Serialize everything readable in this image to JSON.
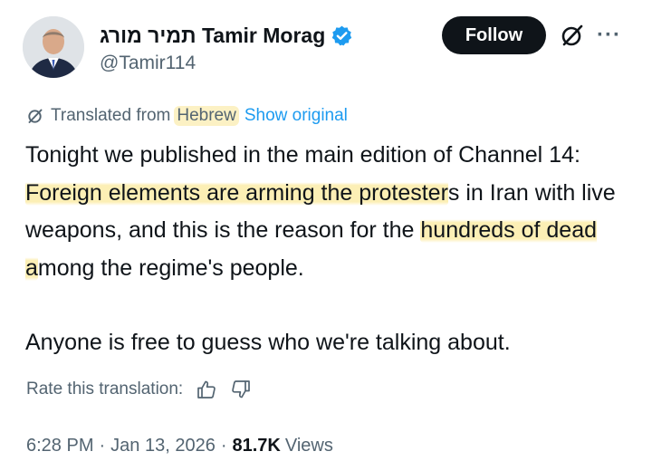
{
  "author": {
    "display_name": "תמיר מורג Tamir Morag",
    "handle": "@Tamir114",
    "avatar_icon": "avatar-portrait",
    "verified_icon": "verified-badge-icon"
  },
  "actions": {
    "follow_label": "Follow",
    "grok_icon": "grok-icon",
    "more_label": "···"
  },
  "translation": {
    "prefix": "Translated from",
    "language": "Hebrew",
    "show_original": "Show original",
    "rate_label": "Rate this translation:"
  },
  "tweet": {
    "p1_a": "Tonight we published in the main edition of Channel 14: ",
    "p1_hl1": "Foreign elements are arming the protester",
    "p1_b": "s in Iran with live weapons, and this is the reason for the ",
    "p1_hl2": "hundreds of dead a",
    "p1_c": "mong the regime's people.",
    "p2": "Anyone is free to guess who we're talking about."
  },
  "meta": {
    "time": "6:28 PM",
    "sep1": "·",
    "date": "Jan 13, 2026",
    "sep2": "·",
    "views_count": "81.7K",
    "views_label": "Views"
  },
  "colors": {
    "text": "#0f1419",
    "secondary": "#536471",
    "link": "#1d9bf0",
    "verified": "#1d9bf0",
    "highlight": "#fcecA8",
    "button_bg": "#0f1419"
  }
}
